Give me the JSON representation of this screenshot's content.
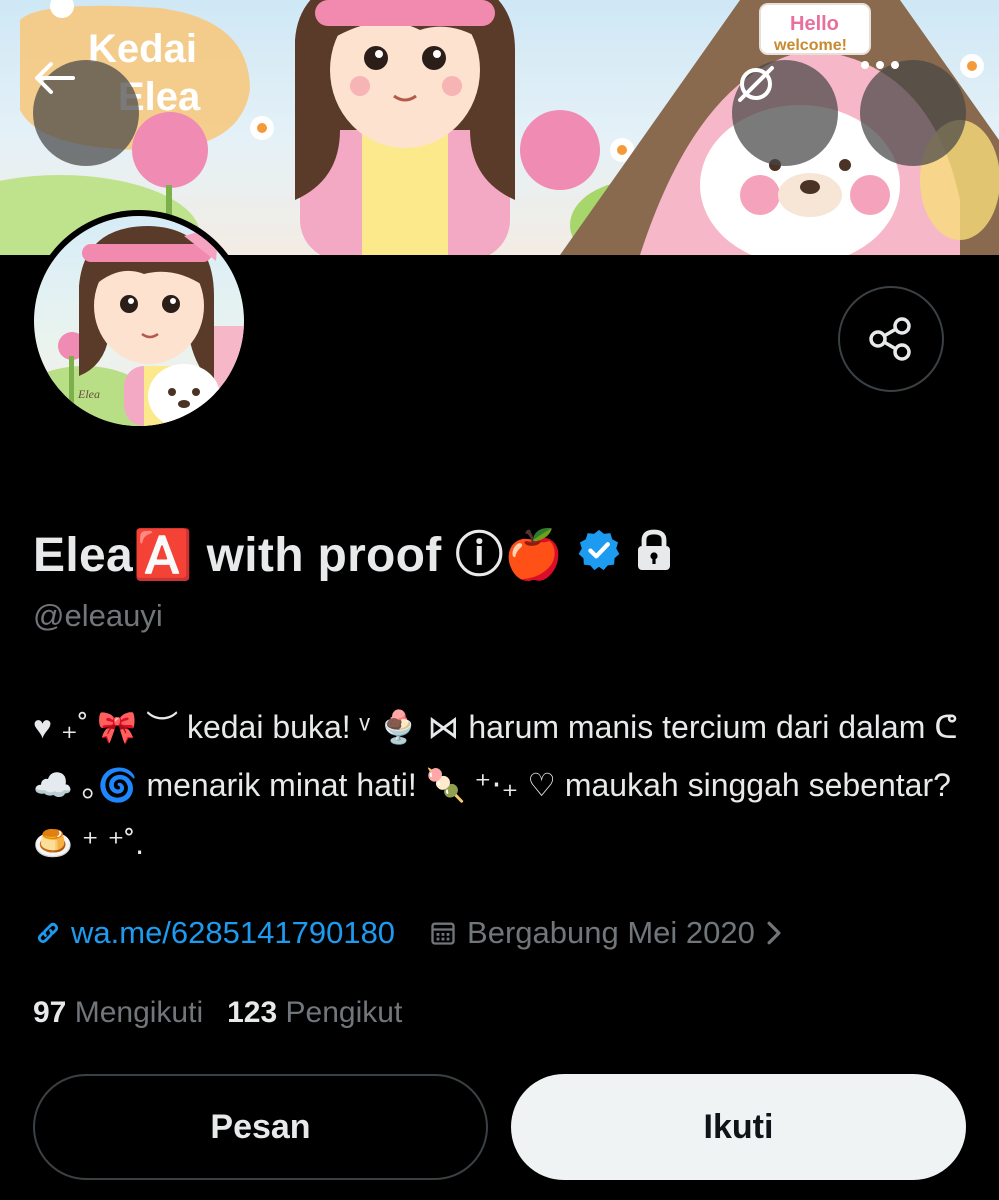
{
  "banner": {
    "logo_line1": "Kedai",
    "logo_line2": "Elea",
    "sign_line1": "Hello",
    "sign_line2": "welcome!"
  },
  "avatar": {
    "signature": "Elea"
  },
  "profile": {
    "display_name": "Elea🅰️ with proof ⓘ🍎",
    "handle": "@eleauyi",
    "bio": "♥︎ ₊˚ 🎀 ︶ kedai buka! ᵛ 🍨 ⋈ harum manis tercium dari dalam ᕦ ☁️ ｡🌀 menarik minat hati! 🍡 ⁺‧₊ ♡ maukah singgah sebentar? 🍮 ⁺ ⁺˚.",
    "link": "wa.me/6285141790180",
    "joined": "Bergabung Mei 2020",
    "following_count": "97",
    "following_label": "Mengikuti",
    "followers_count": "123",
    "followers_label": "Pengikut"
  },
  "actions": {
    "message_label": "Pesan",
    "follow_label": "Ikuti"
  },
  "colors": {
    "background": "#000000",
    "accent_link": "#1d9bf0",
    "verified": "#1d9bf0",
    "secondary_text": "#71767b"
  },
  "icons": [
    "back-arrow-icon",
    "eye-slash-icon",
    "more-dots-icon",
    "share-icon",
    "verified-badge-icon",
    "lock-icon",
    "link-icon",
    "calendar-icon",
    "chevron-right-icon"
  ]
}
